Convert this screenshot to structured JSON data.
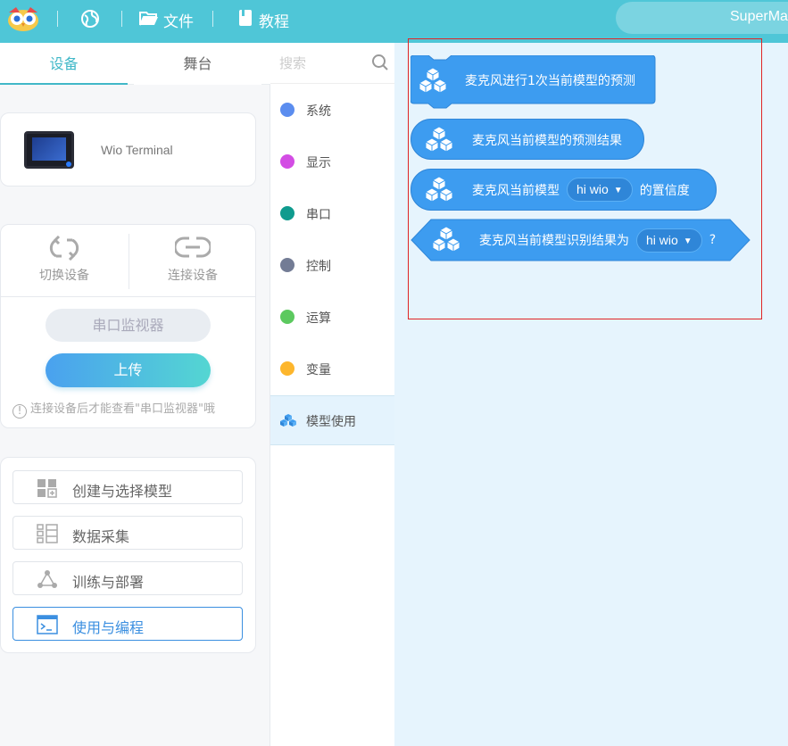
{
  "topbar": {
    "website_label": "",
    "file_label": "文件",
    "tutorial_label": "教程",
    "user_name": "SuperMa"
  },
  "left": {
    "tabs": [
      {
        "label": "设备",
        "active": true
      },
      {
        "label": "舞台",
        "active": false
      }
    ],
    "device_name": "Wio Terminal",
    "switch_device": "切换设备",
    "connect_device": "连接设备",
    "serial_monitor": "串口监视器",
    "upload": "上传",
    "hint": "连接设备后才能查看\"串口监视器\"哦",
    "menu": [
      {
        "label": "创建与选择模型",
        "icon": "grid-add-icon"
      },
      {
        "label": "数据采集",
        "icon": "data-collect-icon"
      },
      {
        "label": "训练与部署",
        "icon": "network-icon"
      },
      {
        "label": "使用与编程",
        "icon": "terminal-icon",
        "active": true
      }
    ]
  },
  "categories": {
    "search_placeholder": "搜索",
    "items": [
      {
        "label": "系统",
        "color": "#5b8def"
      },
      {
        "label": "显示",
        "color": "#d34de4"
      },
      {
        "label": "串口",
        "color": "#0f9b8e"
      },
      {
        "label": "控制",
        "color": "#737c95"
      },
      {
        "label": "运算",
        "color": "#5cc95f"
      },
      {
        "label": "变量",
        "color": "#fdb62c"
      },
      {
        "label": "模型使用",
        "color": "#3d9cf0",
        "selected": true
      }
    ]
  },
  "blocks": [
    {
      "text": "麦克风进行1次当前模型的预测"
    },
    {
      "text": "麦克风当前模型的预测结果"
    },
    {
      "text_before": "麦克风当前模型",
      "dropdown": "hi wio",
      "text_after": "的置信度"
    },
    {
      "text_before": "麦克风当前模型识别结果为",
      "dropdown": "hi wio",
      "text_after": "?"
    }
  ],
  "colors": {
    "accent": "#4fc6d7",
    "block": "#3d9cf0",
    "highlight_box": "#e02525"
  }
}
